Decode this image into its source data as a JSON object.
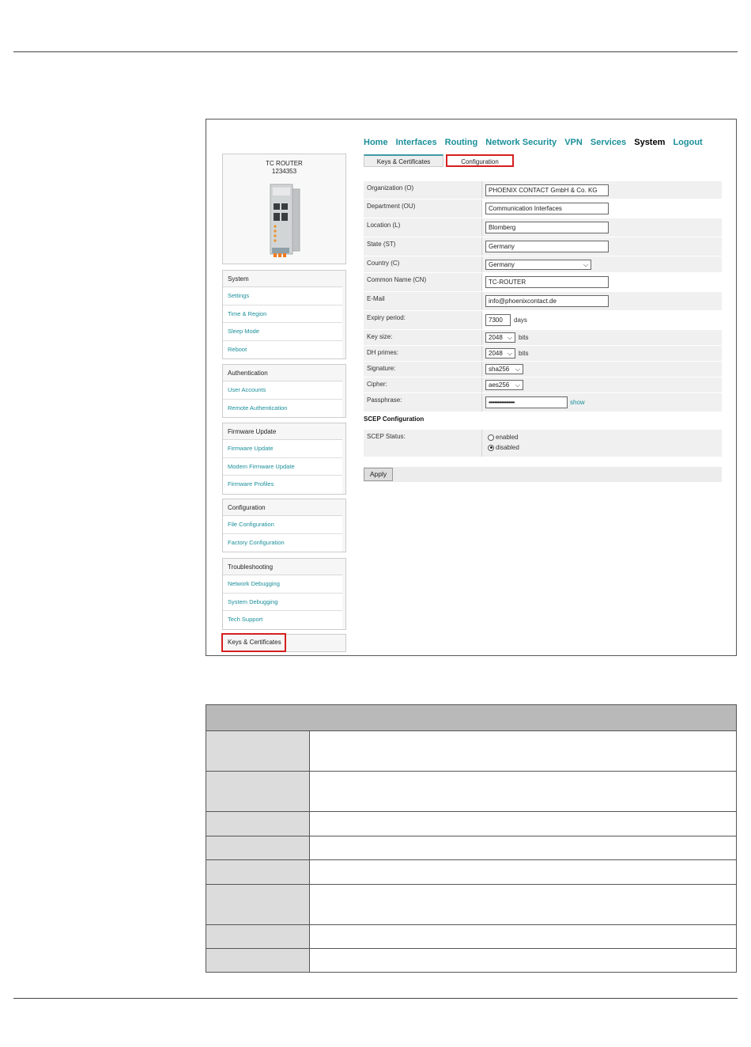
{
  "nav": {
    "items": [
      "Home",
      "Interfaces",
      "Routing",
      "Network Security",
      "VPN",
      "Services",
      "System",
      "Logout"
    ],
    "active": "System"
  },
  "subtabs": [
    "Keys & Certificates",
    "Configuration"
  ],
  "device": {
    "name": "TC ROUTER",
    "number": "1234353"
  },
  "sidebar": [
    {
      "header": "System",
      "items": [
        "Settings",
        "Time & Region",
        "Sleep Mode",
        "Reboot"
      ]
    },
    {
      "header": "Authentication",
      "items": [
        "User Accounts",
        "Remote Authentication"
      ]
    },
    {
      "header": "Firmware Update",
      "items": [
        "Firmware Update",
        "Modem Firmware Update",
        "Firmware Profiles"
      ]
    },
    {
      "header": "Configuration",
      "items": [
        "File Configuration",
        "Factory Configuration"
      ]
    },
    {
      "header": "Troubleshooting",
      "items": [
        "Network Debugging",
        "System Debugging",
        "Tech Support"
      ]
    }
  ],
  "sidebar_selected": "Keys & Certificates",
  "form": {
    "organization": {
      "label": "Organization (O)",
      "value": "PHOENIX CONTACT GmbH & Co. KG"
    },
    "department": {
      "label": "Department (OU)",
      "value": "Communication Interfaces"
    },
    "location": {
      "label": "Location (L)",
      "value": "Blomberg"
    },
    "state": {
      "label": "State (ST)",
      "value": "Germany"
    },
    "country": {
      "label": "Country (C)",
      "value": "Germany"
    },
    "common_name": {
      "label": "Common Name (CN)",
      "value": "TC-ROUTER"
    },
    "email": {
      "label": "E-Mail",
      "value": "info@phoenixcontact.de"
    },
    "expiry": {
      "label": "Expiry period:",
      "value": "7300",
      "unit": "days"
    },
    "key_size": {
      "label": "Key size:",
      "value": "2048",
      "unit": "bits"
    },
    "dh_primes": {
      "label": "DH primes:",
      "value": "2048",
      "unit": "bits"
    },
    "signature": {
      "label": "Signature:",
      "value": "sha256"
    },
    "cipher": {
      "label": "Cipher:",
      "value": "aes256"
    },
    "passphrase": {
      "label": "Passphrase:",
      "value": "••••••••••••••••••",
      "link": "show"
    }
  },
  "scep": {
    "title": "SCEP Configuration",
    "label": "SCEP Status:",
    "options": [
      "enabled",
      "disabled"
    ],
    "selected": "disabled"
  },
  "apply_label": "Apply",
  "colors": {
    "accent": "#1a8f9a",
    "highlight": "#d42020"
  }
}
